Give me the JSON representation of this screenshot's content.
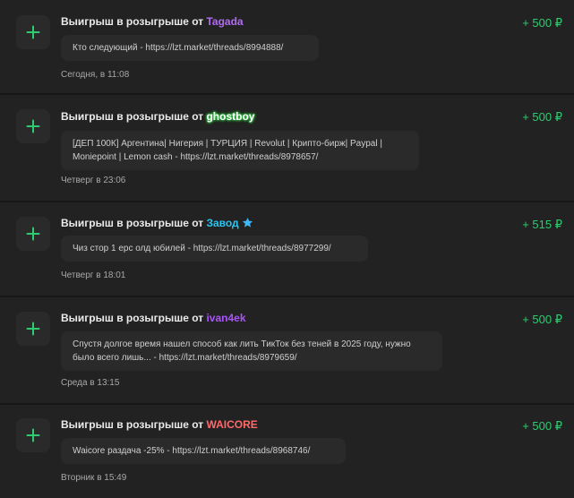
{
  "items": [
    {
      "title_prefix": "Выигрыш в розыгрыше от",
      "user": "Tagada",
      "user_color": "#b26cf2",
      "amount": "+ 500 ₽",
      "message": "Кто следующий - https://lzt.market/threads/8994888/",
      "time": "Сегодня, в 11:08"
    },
    {
      "title_prefix": "Выигрыш в розыгрыше от",
      "user": "ghostboy",
      "user_color": "#ffffff",
      "user_glow": "#2ecc40",
      "amount": "+ 500 ₽",
      "message": "[ДЕП 100К] Аргентина| Нигерия | ТУРЦИЯ | Revolut | Крипто-бирж| Paypal | Moniepoint | Lemon cash - https://lzt.market/threads/8978657/",
      "time": "Четверг в 23:06"
    },
    {
      "title_prefix": "Выигрыш в розыгрыше от",
      "user": "Завод",
      "user_color": "#29c6f2",
      "amount": "+ 515 ₽",
      "message": "Чиз стор 1 epc олд юбилей - https://lzt.market/threads/8977299/",
      "time": "Четверг в 18:01"
    },
    {
      "title_prefix": "Выигрыш в розыгрыше от",
      "user": "ivan4ek",
      "user_color": "#a855f7",
      "amount": "+ 500 ₽",
      "message": "Спустя долгое время нашел способ как лить ТикТок без теней в 2025 году, нужно было всего лишь... - https://lzt.market/threads/8979659/",
      "time": "Среда в 13:15"
    },
    {
      "title_prefix": "Выигрыш в розыгрыше от",
      "user": "WAICORE",
      "user_color": "#ff6b6b",
      "amount": "+ 500 ₽",
      "message": "Waicore раздача -25% - https://lzt.market/threads/8968746/",
      "time": "Вторник в 15:49"
    }
  ],
  "colors": {
    "accent_green": "#2ecc71",
    "background": "#222222"
  },
  "icons": {
    "plus": "plus-icon",
    "star": "star-icon"
  }
}
